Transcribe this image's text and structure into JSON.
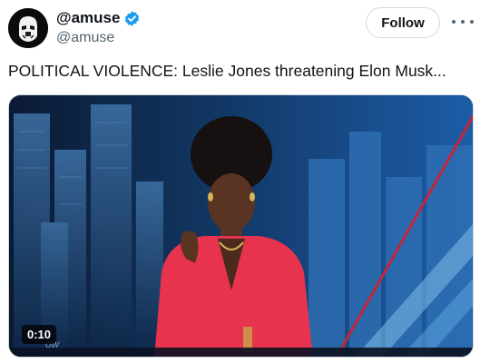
{
  "tweet": {
    "display_name": "@amuse",
    "handle": "@amuse",
    "verified_icon": "verified-badge-icon",
    "follow_label": "Follow",
    "more_icon": "more-options-icon",
    "text": "POLITICAL VIOLENCE: Leslie Jones threatening Elon Musk...",
    "media": {
      "duration": "0:10",
      "watermark": "ow"
    }
  },
  "colors": {
    "verified": "#1d9bf0",
    "text_primary": "#0f1419",
    "text_secondary": "#536471",
    "border": "#cfd9de",
    "jacket": "#e8334f"
  }
}
